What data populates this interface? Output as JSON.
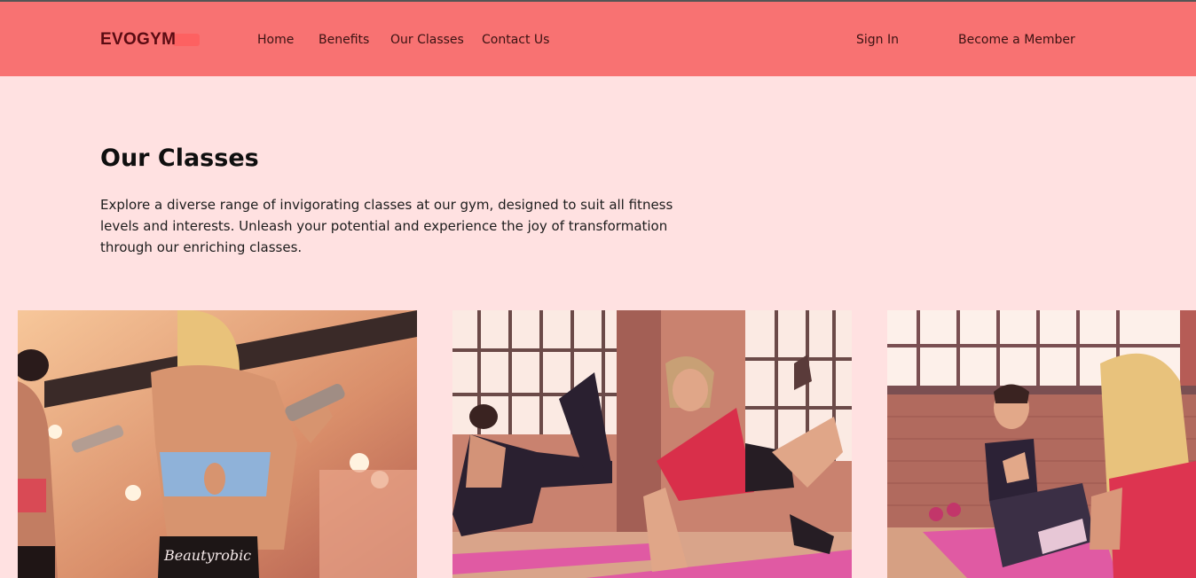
{
  "navbar": {
    "logo": "EVOGYM",
    "links": [
      "Home",
      "Benefits",
      "Our Classes",
      "Contact Us"
    ],
    "sign_in": "Sign In",
    "cta": "Become a Member"
  },
  "classes": {
    "title": "Our Classes",
    "description": "Explore a diverse range of invigorating classes at our gym, designed to suit all fitness levels and interests. Unleash your potential and experience the joy of transformation through our enriching classes.",
    "shirt_text": "Beautyrobic"
  },
  "colors": {
    "navbar_bg": "#f87272",
    "page_bg": "#ffe1e1",
    "logo": "#5a0b12"
  }
}
